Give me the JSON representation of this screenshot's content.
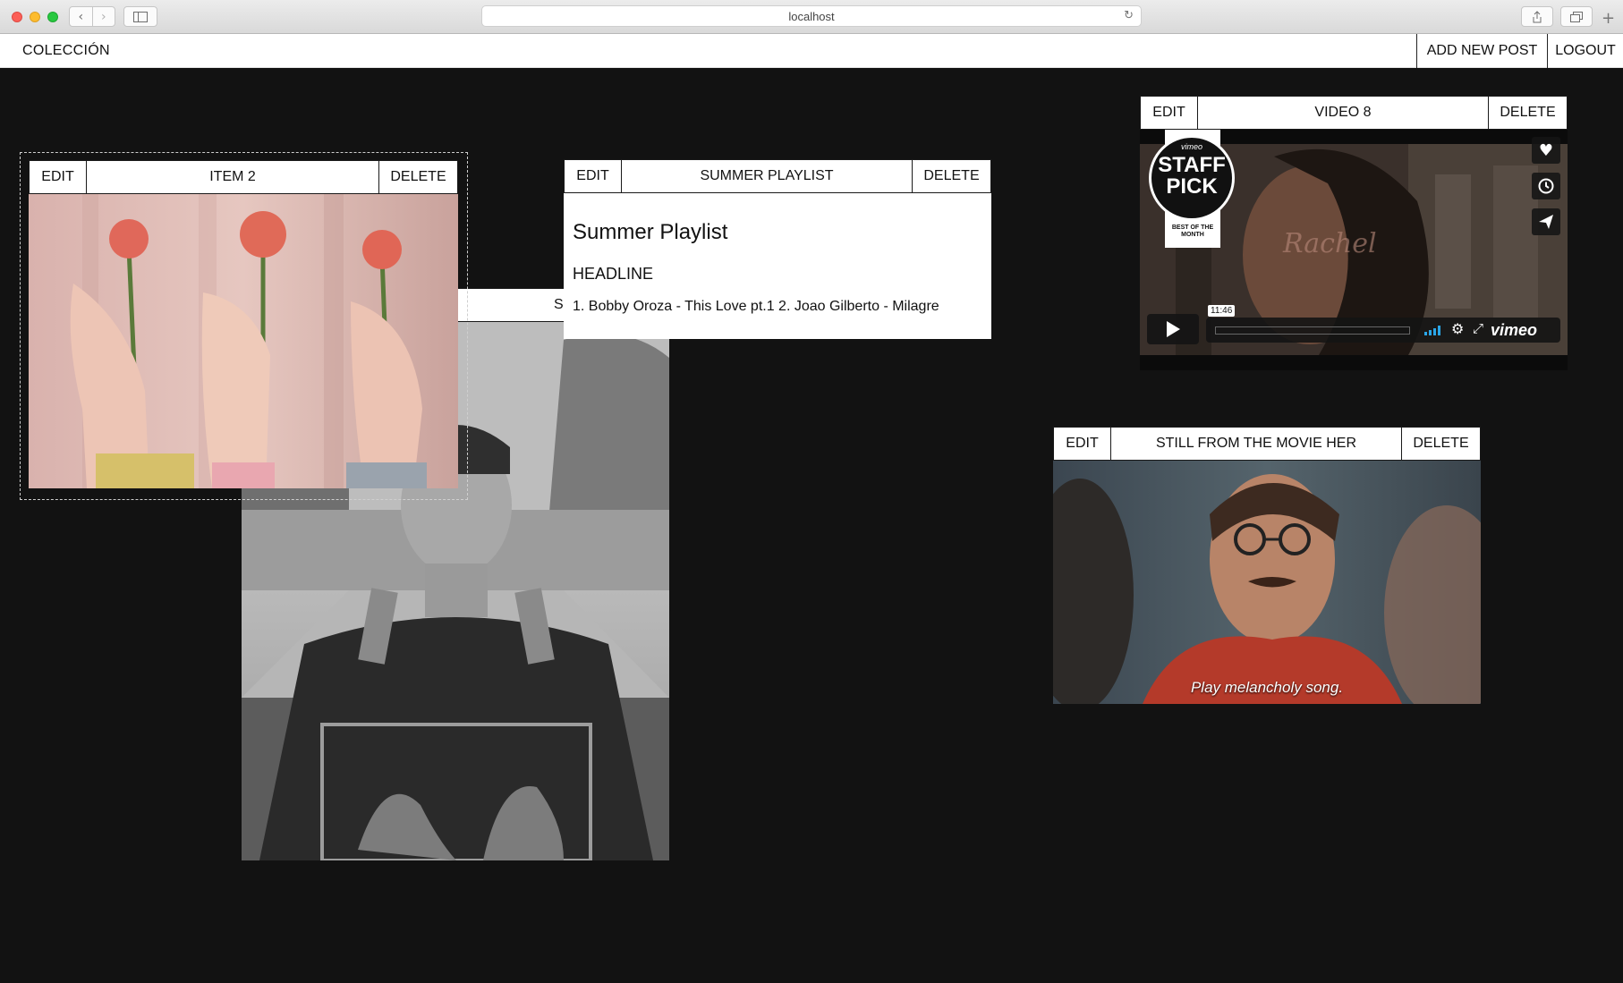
{
  "browser": {
    "url": "localhost"
  },
  "nav": {
    "brand": "COLECCIÓN",
    "add_new": "ADD NEW POST",
    "logout": "LOGOUT"
  },
  "cards": {
    "back": {
      "title": "SDF"
    },
    "item2": {
      "edit": "EDIT",
      "title": "ITEM 2",
      "delete": "DELETE"
    },
    "playlist": {
      "edit": "EDIT",
      "title": "SUMMER PLAYLIST",
      "delete": "DELETE",
      "heading": "Summer Playlist",
      "headline": "HEADLINE",
      "body": "1. Bobby Oroza - This Love pt.1 2. Joao Gilberto - Milagre"
    },
    "video": {
      "edit": "EDIT",
      "title": "VIDEO 8",
      "delete": "DELETE",
      "badge_top": "vimeo",
      "badge_line1": "STAFF",
      "badge_line2": "PICK",
      "badge_ribbon": "BEST OF THE MONTH",
      "timecode": "11:46",
      "logo": "vimeo",
      "watermark": "Rachel"
    },
    "her": {
      "edit": "EDIT",
      "title": "STILL FROM THE MOVIE HER",
      "delete": "DELETE",
      "subtitle": "Play melancholy song."
    }
  }
}
